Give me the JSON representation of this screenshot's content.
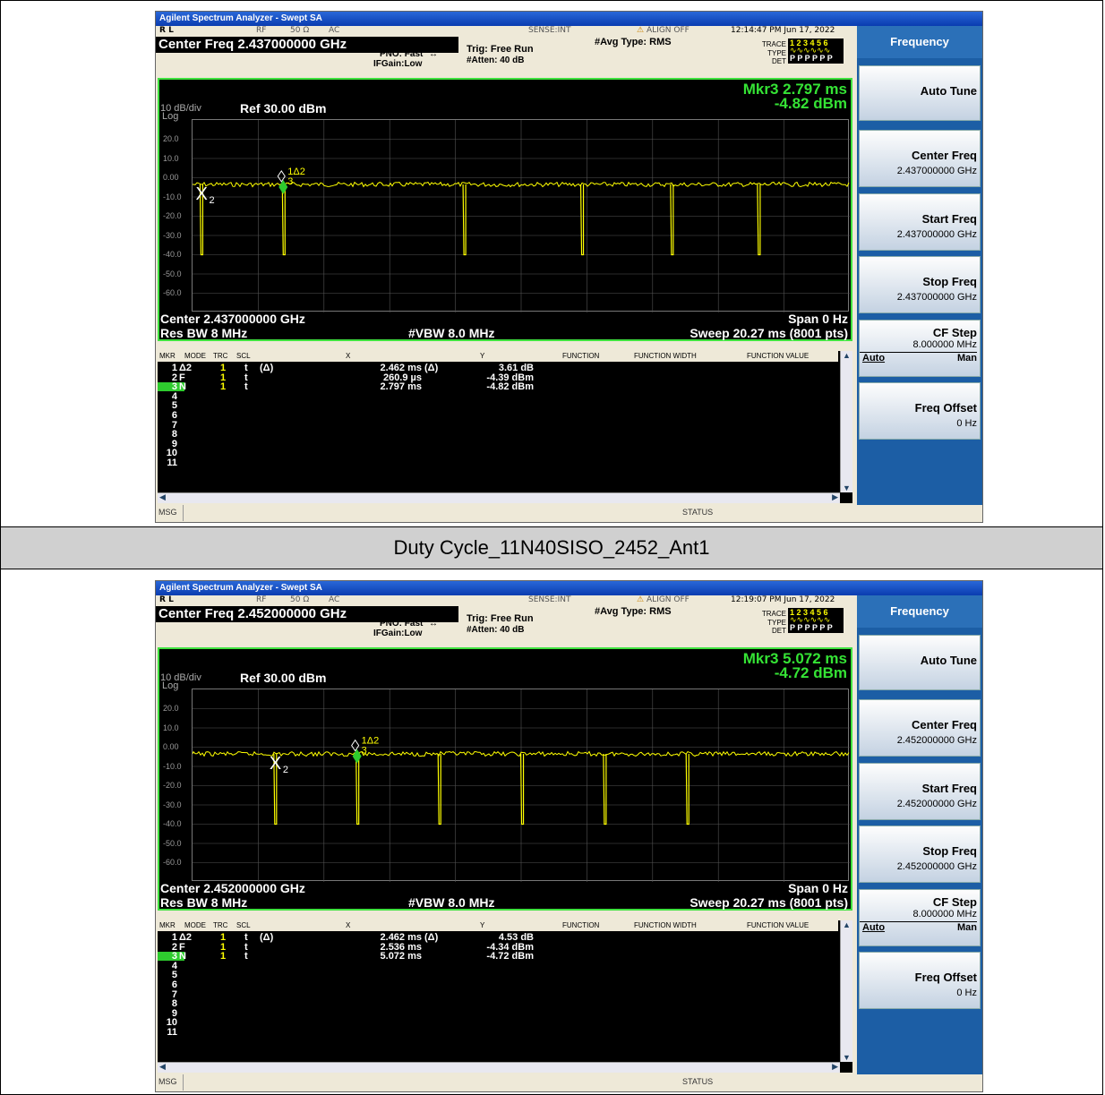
{
  "caption": "Duty Cycle_11N40SISO_2452_Ant1",
  "panels": [
    {
      "title": "Agilent Spectrum Analyzer - Swept SA",
      "status": {
        "rl": "R L",
        "rf": "RF",
        "ohm": "50 Ω",
        "ac": "AC",
        "sense": "SENSE:INT",
        "align": "ALIGN OFF",
        "timestamp": "12:14:47 PM Jun 17, 2022"
      },
      "center_freq_bar": "Center Freq 2.437000000 GHz",
      "pno": "PNO: Fast",
      "ifgain": "IFGain:Low",
      "trig": "Trig: Free Run",
      "atten": "#Atten: 40 dB",
      "avg_type": "#Avg Type: RMS",
      "trace": {
        "trace_label": "TRACE",
        "type_label": "TYPE",
        "det_label": "DET",
        "trace_nums": "1 2 3 4 5 6",
        "det_vals": "P P P P P P"
      },
      "marker_readout": {
        "line1": "Mkr3 2.797 ms",
        "line2": "-4.82 dBm"
      },
      "scale": {
        "div": "10 dB/div",
        "log": "Log",
        "ref": "Ref 30.00 dBm"
      },
      "y_ticks": [
        "20.0",
        "10.0",
        "0.00",
        "-10.0",
        "-20.0",
        "-30.0",
        "-40.0",
        "-50.0",
        "-60.0"
      ],
      "bottom": {
        "center": "Center 2.437000000 GHz",
        "span": "Span 0 Hz",
        "rbw": "Res BW 8 MHz",
        "vbw": "#VBW 8.0 MHz",
        "sweep": "Sweep  20.27 ms (8001 pts)"
      },
      "table_headers": [
        "MKR",
        "MODE",
        "TRC",
        "SCL",
        "X",
        "Y",
        "FUNCTION",
        "FUNCTION WIDTH",
        "FUNCTION VALUE"
      ],
      "rows": [
        {
          "n": "1",
          "mode": "Δ2",
          "trc": "1",
          "scl": "t",
          "d": "(Δ)",
          "x": "2.462 ms",
          "d2": "(Δ)",
          "y": "3.61 dB"
        },
        {
          "n": "2",
          "mode": "F",
          "trc": "1",
          "scl": "t",
          "d": "",
          "x": "260.9 µs",
          "d2": "",
          "y": "-4.39 dBm"
        },
        {
          "n": "3",
          "mode": "N",
          "trc": "1",
          "scl": "t",
          "d": "",
          "x": "2.797 ms",
          "d2": "",
          "y": "-4.82 dBm"
        },
        {
          "n": "4"
        },
        {
          "n": "5"
        },
        {
          "n": "6"
        },
        {
          "n": "7"
        },
        {
          "n": "8"
        },
        {
          "n": "9"
        },
        {
          "n": "10"
        },
        {
          "n": "11"
        }
      ],
      "msg": "MSG",
      "status_label": "STATUS",
      "softkeys": {
        "title": "Frequency",
        "auto_tune": "Auto Tune",
        "center_freq": "Center Freq",
        "center_val": "2.437000000 GHz",
        "start_freq": "Start Freq",
        "start_val": "2.437000000 GHz",
        "stop_freq": "Stop Freq",
        "stop_val": "2.437000000 GHz",
        "cf_step": "CF Step",
        "cf_val": "8.000000 MHz",
        "auto": "Auto",
        "man": "Man",
        "freq_offset": "Freq Offset",
        "offset_val": "0 Hz"
      },
      "markers": {
        "m2_label": "2",
        "m1_label": "1Δ2",
        "m3_label": "3"
      }
    },
    {
      "title": "Agilent Spectrum Analyzer - Swept SA",
      "status": {
        "rl": "R L",
        "rf": "RF",
        "ohm": "50 Ω",
        "ac": "AC",
        "sense": "SENSE:INT",
        "align": "ALIGN OFF",
        "timestamp": "12:19:07 PM Jun 17, 2022"
      },
      "center_freq_bar": "Center Freq 2.452000000 GHz",
      "pno": "PNO: Fast",
      "ifgain": "IFGain:Low",
      "trig": "Trig: Free Run",
      "atten": "#Atten: 40 dB",
      "avg_type": "#Avg Type: RMS",
      "trace": {
        "trace_label": "TRACE",
        "type_label": "TYPE",
        "det_label": "DET",
        "trace_nums": "1 2 3 4 5 6",
        "det_vals": "P P P P P P"
      },
      "marker_readout": {
        "line1": "Mkr3 5.072 ms",
        "line2": "-4.72 dBm"
      },
      "scale": {
        "div": "10 dB/div",
        "log": "Log",
        "ref": "Ref 30.00 dBm"
      },
      "y_ticks": [
        "20.0",
        "10.0",
        "0.00",
        "-10.0",
        "-20.0",
        "-30.0",
        "-40.0",
        "-50.0",
        "-60.0"
      ],
      "bottom": {
        "center": "Center 2.452000000 GHz",
        "span": "Span 0 Hz",
        "rbw": "Res BW 8 MHz",
        "vbw": "#VBW 8.0 MHz",
        "sweep": "Sweep  20.27 ms (8001 pts)"
      },
      "table_headers": [
        "MKR",
        "MODE",
        "TRC",
        "SCL",
        "X",
        "Y",
        "FUNCTION",
        "FUNCTION WIDTH",
        "FUNCTION VALUE"
      ],
      "rows": [
        {
          "n": "1",
          "mode": "Δ2",
          "trc": "1",
          "scl": "t",
          "d": "(Δ)",
          "x": "2.462 ms",
          "d2": "(Δ)",
          "y": "4.53 dB"
        },
        {
          "n": "2",
          "mode": "F",
          "trc": "1",
          "scl": "t",
          "d": "",
          "x": "2.536 ms",
          "d2": "",
          "y": "-4.34 dBm"
        },
        {
          "n": "3",
          "mode": "N",
          "trc": "1",
          "scl": "t",
          "d": "",
          "x": "5.072 ms",
          "d2": "",
          "y": "-4.72 dBm"
        },
        {
          "n": "4"
        },
        {
          "n": "5"
        },
        {
          "n": "6"
        },
        {
          "n": "7"
        },
        {
          "n": "8"
        },
        {
          "n": "9"
        },
        {
          "n": "10"
        },
        {
          "n": "11"
        }
      ],
      "msg": "MSG",
      "status_label": "STATUS",
      "softkeys": {
        "title": "Frequency",
        "auto_tune": "Auto Tune",
        "center_freq": "Center Freq",
        "center_val": "2.452000000 GHz",
        "start_freq": "Start Freq",
        "start_val": "2.452000000 GHz",
        "stop_freq": "Stop Freq",
        "stop_val": "2.452000000 GHz",
        "cf_step": "CF Step",
        "cf_val": "8.000000 MHz",
        "auto": "Auto",
        "man": "Man",
        "freq_offset": "Freq Offset",
        "offset_val": "0 Hz"
      },
      "markers": {
        "m2_label": "2",
        "m1_label": "1Δ2",
        "m3_label": "3"
      }
    }
  ],
  "chart_data": [
    {
      "type": "line",
      "title": "",
      "xlabel": "",
      "ylabel": "",
      "ylim": [
        -70,
        30
      ],
      "x_units": "ms",
      "xlim": [
        0,
        20.27
      ],
      "series": [
        {
          "baseline_dbm": -3.5,
          "dip_level_dbm": -40,
          "dips_ms": [
            0.26,
            2.797,
            8.37,
            12.0,
            14.77,
            17.45
          ]
        }
      ],
      "markers": [
        {
          "id": "2",
          "x_ms": 0.2609,
          "y_dbm": -4.39,
          "symbol": "X"
        },
        {
          "id": "3",
          "x_ms": 2.797,
          "y_dbm": -4.82,
          "symbol": "diamond"
        }
      ],
      "grid": true
    },
    {
      "type": "line",
      "title": "",
      "xlabel": "",
      "ylabel": "",
      "ylim": [
        -70,
        30
      ],
      "x_units": "ms",
      "xlim": [
        0,
        20.27
      ],
      "series": [
        {
          "baseline_dbm": -3.5,
          "dip_level_dbm": -40,
          "dips_ms": [
            2.536,
            5.072,
            7.6,
            10.15,
            12.7,
            15.25
          ]
        }
      ],
      "markers": [
        {
          "id": "2",
          "x_ms": 2.536,
          "y_dbm": -4.34,
          "symbol": "X"
        },
        {
          "id": "3",
          "x_ms": 5.072,
          "y_dbm": -4.72,
          "symbol": "diamond"
        }
      ],
      "grid": true
    }
  ]
}
